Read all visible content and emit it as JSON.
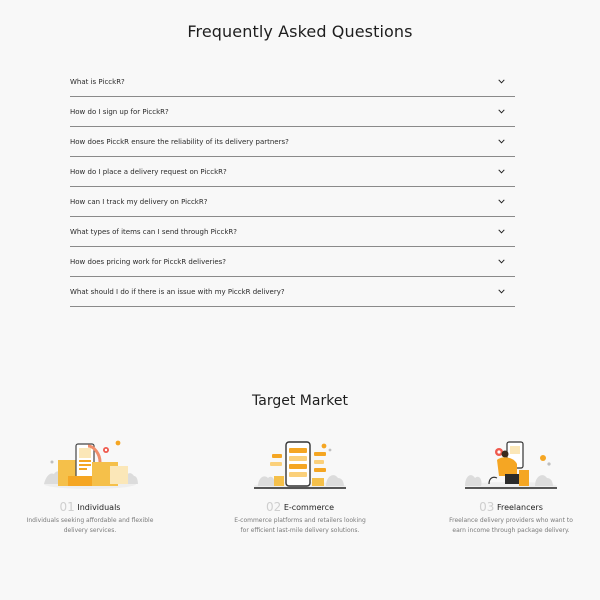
{
  "faq": {
    "title": "Frequently Asked Questions",
    "items": [
      {
        "question": "What is PicckR?"
      },
      {
        "question": "How do I sign up for PicckR?"
      },
      {
        "question": "How does PicckR ensure the reliability of its delivery partners?"
      },
      {
        "question": "How do I place a delivery request on PicckR?"
      },
      {
        "question": "How can I track my delivery on PicckR?"
      },
      {
        "question": "What types of items can I send through PicckR?"
      },
      {
        "question": "How does pricing work for PicckR deliveries?"
      },
      {
        "question": "What should I do if there is an issue with my PicckR delivery?"
      }
    ]
  },
  "target_market": {
    "title": "Target Market",
    "cards": [
      {
        "number": "01",
        "label": "Individuals",
        "description_line1": "Individuals seeking affordable and flexible",
        "description_line2": "delivery services."
      },
      {
        "number": "02",
        "label": "E-commerce",
        "description_line1": "E-commerce platforms and retailers looking",
        "description_line2": "for efficient last-mile delivery solutions."
      },
      {
        "number": "03",
        "label": "Freelancers",
        "description_line1": "Freelance delivery providers who want to",
        "description_line2": "earn income through package delivery."
      }
    ]
  },
  "colors": {
    "accent": "#f5a623",
    "background": "#f8f8f8",
    "divider": "#8a8a8a"
  }
}
